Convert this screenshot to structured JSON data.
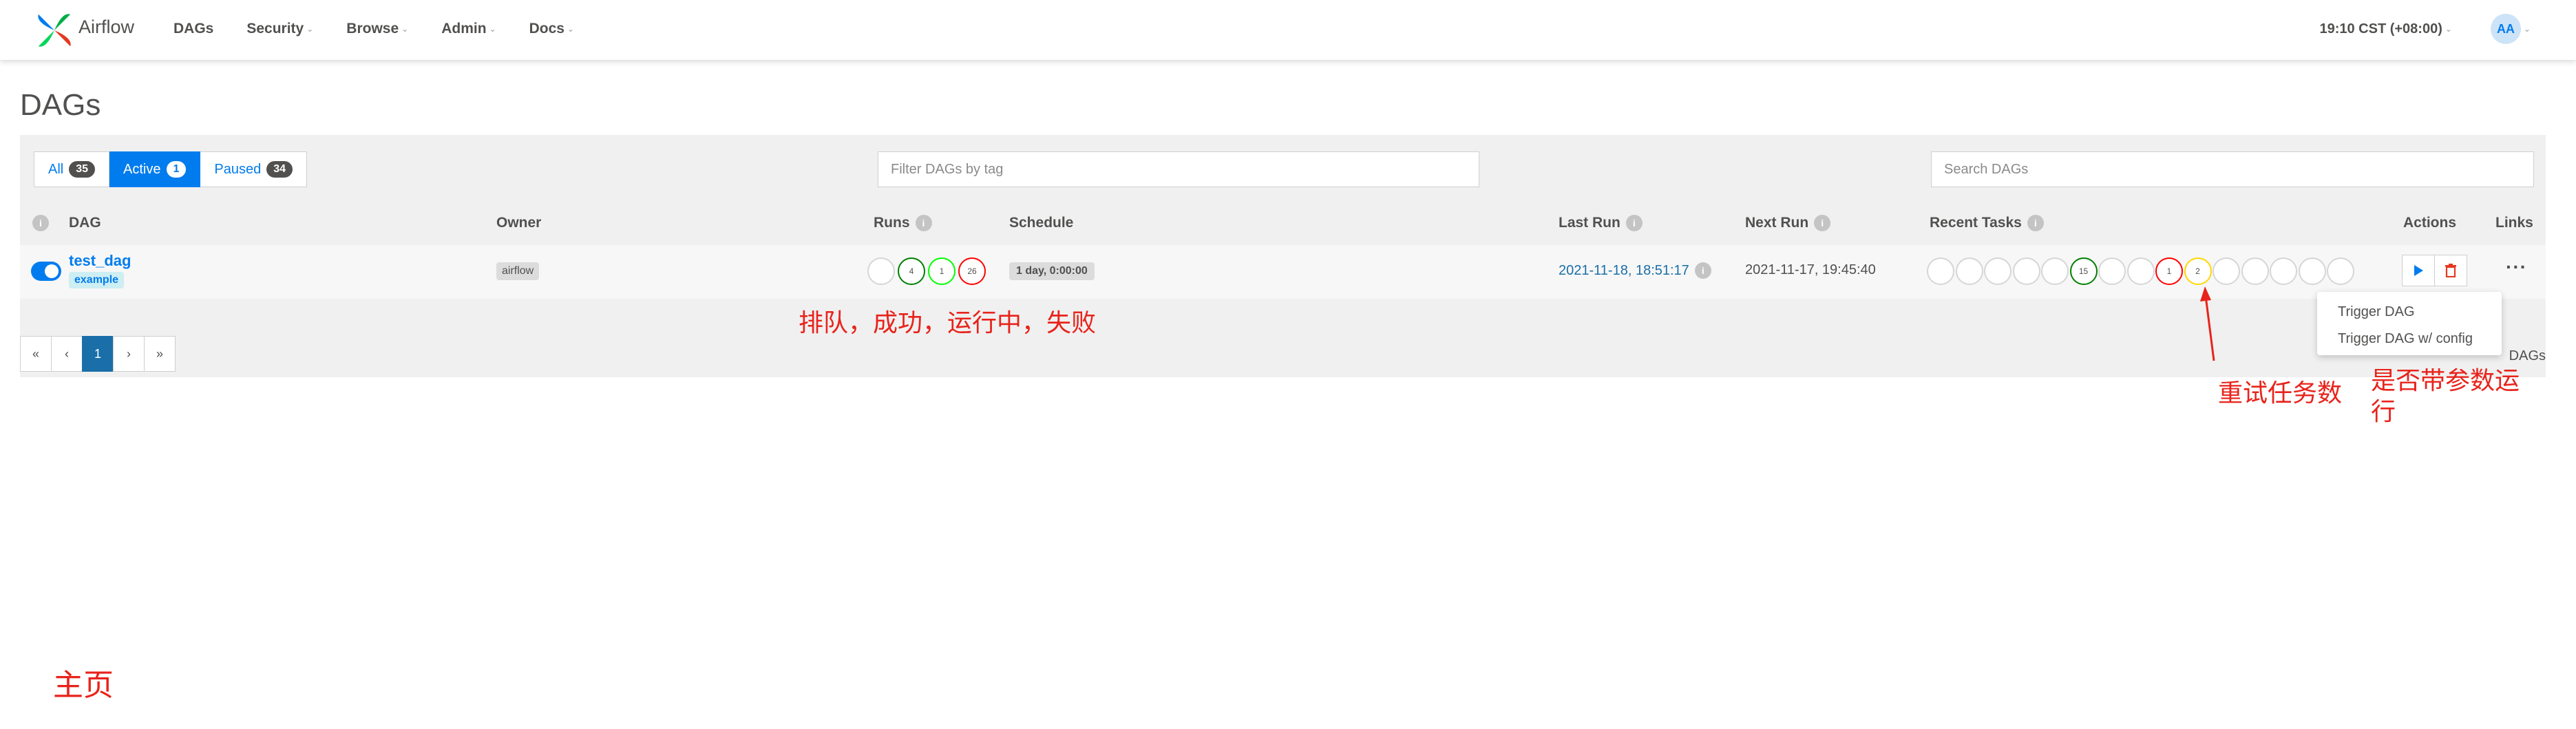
{
  "navbar": {
    "brand": "Airflow",
    "menu": [
      {
        "label": "DAGs",
        "has_caret": false
      },
      {
        "label": "Security",
        "has_caret": true
      },
      {
        "label": "Browse",
        "has_caret": true
      },
      {
        "label": "Admin",
        "has_caret": true
      },
      {
        "label": "Docs",
        "has_caret": true
      }
    ],
    "clock": "19:10 CST (+08:00)",
    "avatar_initials": "AA"
  },
  "page_title": "DAGs",
  "filters": {
    "all_label": "All",
    "all_count": "35",
    "active_label": "Active",
    "active_count": "1",
    "paused_label": "Paused",
    "paused_count": "34",
    "tag_placeholder": "Filter DAGs by tag",
    "search_placeholder": "Search DAGs"
  },
  "table": {
    "headers": {
      "dag": "DAG",
      "owner": "Owner",
      "runs": "Runs",
      "schedule": "Schedule",
      "last_run": "Last Run",
      "next_run": "Next Run",
      "recent_tasks": "Recent Tasks",
      "actions": "Actions",
      "links": "Links"
    },
    "row": {
      "dag_id": "test_dag",
      "tag": "example",
      "owner": "airflow",
      "runs": [
        {
          "state": "queued",
          "count": "",
          "color": "#d6d6d6"
        },
        {
          "state": "success",
          "count": "4",
          "color": "#008000"
        },
        {
          "state": "running",
          "count": "1",
          "color": "#00ff00"
        },
        {
          "state": "failed",
          "count": "26",
          "color": "#ff0000"
        }
      ],
      "schedule": "1 day, 0:00:00",
      "last_run_date": "2021-11-18",
      "last_run_time": "18:51:17",
      "next_run": "2021-11-17, 19:45:40",
      "recent_tasks": [
        {
          "count": "",
          "color": "#d6d6d6"
        },
        {
          "count": "",
          "color": "#d6d6d6"
        },
        {
          "count": "",
          "color": "#d6d6d6"
        },
        {
          "count": "",
          "color": "#d6d6d6"
        },
        {
          "count": "",
          "color": "#d6d6d6"
        },
        {
          "count": "15",
          "color": "#008000"
        },
        {
          "count": "",
          "color": "#d6d6d6"
        },
        {
          "count": "",
          "color": "#d6d6d6"
        },
        {
          "count": "1",
          "color": "#ff0000"
        },
        {
          "count": "2",
          "color": "#ffd700"
        },
        {
          "count": "",
          "color": "#d6d6d6"
        },
        {
          "count": "",
          "color": "#d6d6d6"
        },
        {
          "count": "",
          "color": "#d6d6d6"
        },
        {
          "count": "",
          "color": "#d6d6d6"
        },
        {
          "count": "",
          "color": "#d6d6d6"
        }
      ],
      "actions": {
        "trigger_icon": "play-icon",
        "delete_icon": "trash-icon"
      },
      "links": "···"
    }
  },
  "pagination": {
    "first": "«",
    "prev": "‹",
    "current": "1",
    "next": "›",
    "last": "»"
  },
  "summary": "DAGs",
  "dropdown": {
    "trigger": "Trigger DAG",
    "trigger_config": "Trigger DAG w/ config"
  },
  "annotations": {
    "runs": "排队，成功，运行中，失败",
    "retry": "重试任务数",
    "trigger": "是否带参数运行",
    "home": "主页"
  },
  "colors": {
    "accent": "#017cee",
    "annotation": "#e8231b"
  }
}
